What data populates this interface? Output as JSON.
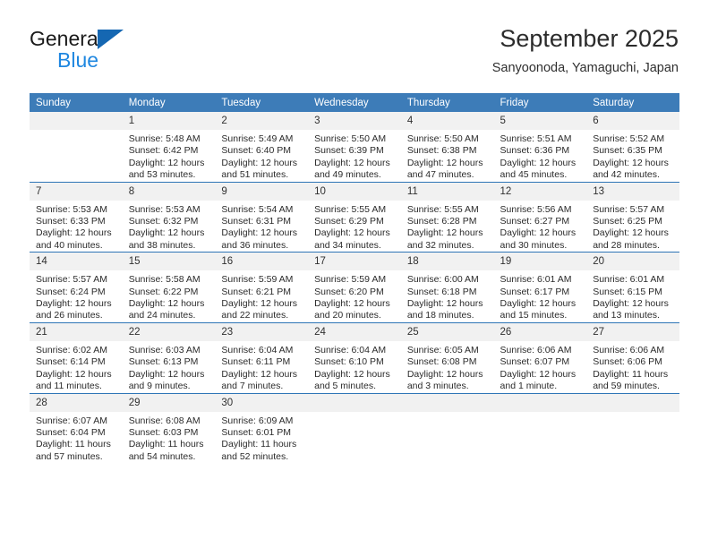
{
  "brand": {
    "name_top": "General",
    "name_bottom": "Blue",
    "accent_color": "#1567b2",
    "blue_text_color": "#1f87e0"
  },
  "header": {
    "title": "September 2025",
    "subtitle": "Sanyoonoda, Yamaguchi, Japan"
  },
  "theme": {
    "header_row_color": "#3d7cb8",
    "row_divider_color": "#2e75b6",
    "daynum_band_color": "#f1f1f1"
  },
  "weekdays": [
    "Sunday",
    "Monday",
    "Tuesday",
    "Wednesday",
    "Thursday",
    "Friday",
    "Saturday"
  ],
  "weeks": [
    [
      {
        "day": "",
        "sunrise": "",
        "sunset": "",
        "daylight_line1": "",
        "daylight_line2": "",
        "empty": true
      },
      {
        "day": "1",
        "sunrise": "Sunrise: 5:48 AM",
        "sunset": "Sunset: 6:42 PM",
        "daylight_line1": "Daylight: 12 hours",
        "daylight_line2": "and 53 minutes."
      },
      {
        "day": "2",
        "sunrise": "Sunrise: 5:49 AM",
        "sunset": "Sunset: 6:40 PM",
        "daylight_line1": "Daylight: 12 hours",
        "daylight_line2": "and 51 minutes."
      },
      {
        "day": "3",
        "sunrise": "Sunrise: 5:50 AM",
        "sunset": "Sunset: 6:39 PM",
        "daylight_line1": "Daylight: 12 hours",
        "daylight_line2": "and 49 minutes."
      },
      {
        "day": "4",
        "sunrise": "Sunrise: 5:50 AM",
        "sunset": "Sunset: 6:38 PM",
        "daylight_line1": "Daylight: 12 hours",
        "daylight_line2": "and 47 minutes."
      },
      {
        "day": "5",
        "sunrise": "Sunrise: 5:51 AM",
        "sunset": "Sunset: 6:36 PM",
        "daylight_line1": "Daylight: 12 hours",
        "daylight_line2": "and 45 minutes."
      },
      {
        "day": "6",
        "sunrise": "Sunrise: 5:52 AM",
        "sunset": "Sunset: 6:35 PM",
        "daylight_line1": "Daylight: 12 hours",
        "daylight_line2": "and 42 minutes."
      }
    ],
    [
      {
        "day": "7",
        "sunrise": "Sunrise: 5:53 AM",
        "sunset": "Sunset: 6:33 PM",
        "daylight_line1": "Daylight: 12 hours",
        "daylight_line2": "and 40 minutes."
      },
      {
        "day": "8",
        "sunrise": "Sunrise: 5:53 AM",
        "sunset": "Sunset: 6:32 PM",
        "daylight_line1": "Daylight: 12 hours",
        "daylight_line2": "and 38 minutes."
      },
      {
        "day": "9",
        "sunrise": "Sunrise: 5:54 AM",
        "sunset": "Sunset: 6:31 PM",
        "daylight_line1": "Daylight: 12 hours",
        "daylight_line2": "and 36 minutes."
      },
      {
        "day": "10",
        "sunrise": "Sunrise: 5:55 AM",
        "sunset": "Sunset: 6:29 PM",
        "daylight_line1": "Daylight: 12 hours",
        "daylight_line2": "and 34 minutes."
      },
      {
        "day": "11",
        "sunrise": "Sunrise: 5:55 AM",
        "sunset": "Sunset: 6:28 PM",
        "daylight_line1": "Daylight: 12 hours",
        "daylight_line2": "and 32 minutes."
      },
      {
        "day": "12",
        "sunrise": "Sunrise: 5:56 AM",
        "sunset": "Sunset: 6:27 PM",
        "daylight_line1": "Daylight: 12 hours",
        "daylight_line2": "and 30 minutes."
      },
      {
        "day": "13",
        "sunrise": "Sunrise: 5:57 AM",
        "sunset": "Sunset: 6:25 PM",
        "daylight_line1": "Daylight: 12 hours",
        "daylight_line2": "and 28 minutes."
      }
    ],
    [
      {
        "day": "14",
        "sunrise": "Sunrise: 5:57 AM",
        "sunset": "Sunset: 6:24 PM",
        "daylight_line1": "Daylight: 12 hours",
        "daylight_line2": "and 26 minutes."
      },
      {
        "day": "15",
        "sunrise": "Sunrise: 5:58 AM",
        "sunset": "Sunset: 6:22 PM",
        "daylight_line1": "Daylight: 12 hours",
        "daylight_line2": "and 24 minutes."
      },
      {
        "day": "16",
        "sunrise": "Sunrise: 5:59 AM",
        "sunset": "Sunset: 6:21 PM",
        "daylight_line1": "Daylight: 12 hours",
        "daylight_line2": "and 22 minutes."
      },
      {
        "day": "17",
        "sunrise": "Sunrise: 5:59 AM",
        "sunset": "Sunset: 6:20 PM",
        "daylight_line1": "Daylight: 12 hours",
        "daylight_line2": "and 20 minutes."
      },
      {
        "day": "18",
        "sunrise": "Sunrise: 6:00 AM",
        "sunset": "Sunset: 6:18 PM",
        "daylight_line1": "Daylight: 12 hours",
        "daylight_line2": "and 18 minutes."
      },
      {
        "day": "19",
        "sunrise": "Sunrise: 6:01 AM",
        "sunset": "Sunset: 6:17 PM",
        "daylight_line1": "Daylight: 12 hours",
        "daylight_line2": "and 15 minutes."
      },
      {
        "day": "20",
        "sunrise": "Sunrise: 6:01 AM",
        "sunset": "Sunset: 6:15 PM",
        "daylight_line1": "Daylight: 12 hours",
        "daylight_line2": "and 13 minutes."
      }
    ],
    [
      {
        "day": "21",
        "sunrise": "Sunrise: 6:02 AM",
        "sunset": "Sunset: 6:14 PM",
        "daylight_line1": "Daylight: 12 hours",
        "daylight_line2": "and 11 minutes."
      },
      {
        "day": "22",
        "sunrise": "Sunrise: 6:03 AM",
        "sunset": "Sunset: 6:13 PM",
        "daylight_line1": "Daylight: 12 hours",
        "daylight_line2": "and 9 minutes."
      },
      {
        "day": "23",
        "sunrise": "Sunrise: 6:04 AM",
        "sunset": "Sunset: 6:11 PM",
        "daylight_line1": "Daylight: 12 hours",
        "daylight_line2": "and 7 minutes."
      },
      {
        "day": "24",
        "sunrise": "Sunrise: 6:04 AM",
        "sunset": "Sunset: 6:10 PM",
        "daylight_line1": "Daylight: 12 hours",
        "daylight_line2": "and 5 minutes."
      },
      {
        "day": "25",
        "sunrise": "Sunrise: 6:05 AM",
        "sunset": "Sunset: 6:08 PM",
        "daylight_line1": "Daylight: 12 hours",
        "daylight_line2": "and 3 minutes."
      },
      {
        "day": "26",
        "sunrise": "Sunrise: 6:06 AM",
        "sunset": "Sunset: 6:07 PM",
        "daylight_line1": "Daylight: 12 hours",
        "daylight_line2": "and 1 minute."
      },
      {
        "day": "27",
        "sunrise": "Sunrise: 6:06 AM",
        "sunset": "Sunset: 6:06 PM",
        "daylight_line1": "Daylight: 11 hours",
        "daylight_line2": "and 59 minutes."
      }
    ],
    [
      {
        "day": "28",
        "sunrise": "Sunrise: 6:07 AM",
        "sunset": "Sunset: 6:04 PM",
        "daylight_line1": "Daylight: 11 hours",
        "daylight_line2": "and 57 minutes."
      },
      {
        "day": "29",
        "sunrise": "Sunrise: 6:08 AM",
        "sunset": "Sunset: 6:03 PM",
        "daylight_line1": "Daylight: 11 hours",
        "daylight_line2": "and 54 minutes."
      },
      {
        "day": "30",
        "sunrise": "Sunrise: 6:09 AM",
        "sunset": "Sunset: 6:01 PM",
        "daylight_line1": "Daylight: 11 hours",
        "daylight_line2": "and 52 minutes."
      },
      {
        "day": "",
        "sunrise": "",
        "sunset": "",
        "daylight_line1": "",
        "daylight_line2": "",
        "empty": true
      },
      {
        "day": "",
        "sunrise": "",
        "sunset": "",
        "daylight_line1": "",
        "daylight_line2": "",
        "empty": true
      },
      {
        "day": "",
        "sunrise": "",
        "sunset": "",
        "daylight_line1": "",
        "daylight_line2": "",
        "empty": true
      },
      {
        "day": "",
        "sunrise": "",
        "sunset": "",
        "daylight_line1": "",
        "daylight_line2": "",
        "empty": true
      }
    ]
  ]
}
